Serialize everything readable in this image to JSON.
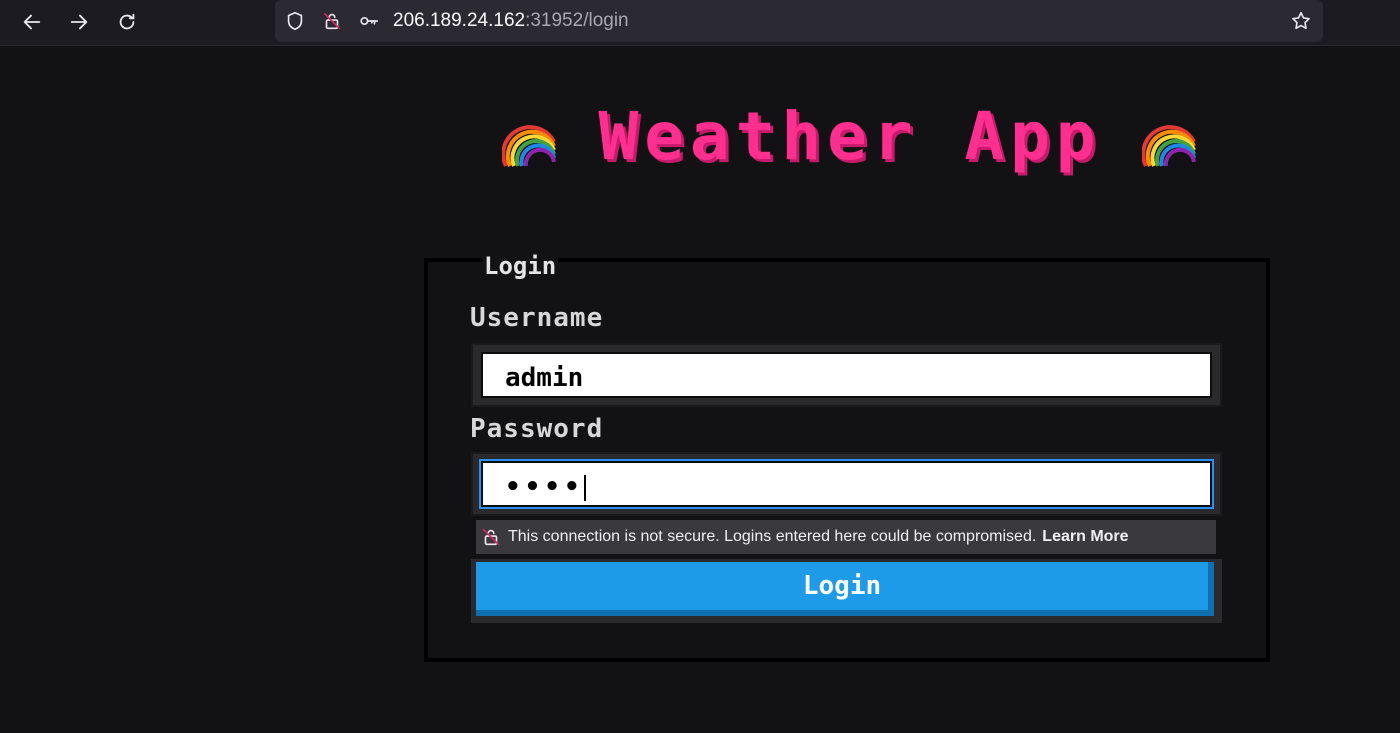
{
  "browser": {
    "url_host": "206.189.24.162",
    "url_rest": ":31952/login"
  },
  "page": {
    "title": "Weather App",
    "form_legend": "Login",
    "username_label": "Username",
    "username_value": "admin",
    "password_label": "Password",
    "password_value": "••••",
    "security_warning": "This connection is not secure. Logins entered here could be compromised.",
    "learn_more": "Learn More",
    "login_button": "Login"
  },
  "colors": {
    "title": "#ff2e8f",
    "button": "#1e9be8",
    "focus_ring": "#2a90f5"
  }
}
